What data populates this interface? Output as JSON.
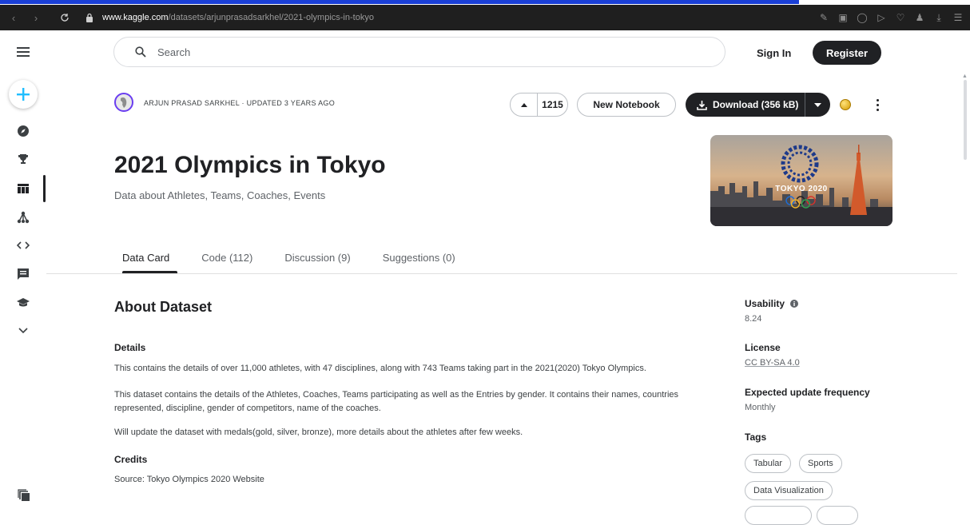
{
  "browser": {
    "url_domain": "www.kaggle.com",
    "url_path": "/datasets/arjunprasadsarkhel/2021-olympics-in-tokyo"
  },
  "header": {
    "search_placeholder": "Search",
    "sign_in": "Sign In",
    "register": "Register"
  },
  "dataset": {
    "meta": "ARJUN PRASAD SARKHEL · UPDATED 3 YEARS AGO",
    "votes": "1215",
    "new_notebook": "New Notebook",
    "download": "Download (356 kB)",
    "title": "2021 Olympics in Tokyo",
    "subtitle": "Data about Athletes, Teams, Coaches, Events",
    "cover_text": "TOKYO 2020"
  },
  "tabs": [
    {
      "label": "Data Card"
    },
    {
      "label": "Code (112)"
    },
    {
      "label": "Discussion (9)"
    },
    {
      "label": "Suggestions (0)"
    }
  ],
  "about": {
    "heading": "About Dataset",
    "details_heading": "Details",
    "p1": "This contains the details of over 11,000 athletes, with 47 disciplines, along with 743 Teams taking part in the 2021(2020) Tokyo Olympics.",
    "p2": "This dataset contains the details of the Athletes, Coaches, Teams participating as well as the Entries by gender. It contains their names, countries represented, discipline, gender of competitors, name of the coaches.",
    "p3": "Will update the dataset with medals(gold, silver, bronze), more details about the athletes after few weeks.",
    "credits_heading": "Credits",
    "credits": "Source: Tokyo Olympics 2020 Website"
  },
  "sidebar": {
    "usability_label": "Usability",
    "usability_value": "8.24",
    "license_label": "License",
    "license_value": "CC BY-SA 4.0",
    "frequency_label": "Expected update frequency",
    "frequency_value": "Monthly",
    "tags_label": "Tags",
    "tags": [
      "Tabular",
      "Sports",
      "Data Visualization"
    ]
  },
  "colors": {
    "accent_dark": "#202124",
    "browser_bar": "#1f1f1f",
    "create_plus": "#20beff"
  }
}
